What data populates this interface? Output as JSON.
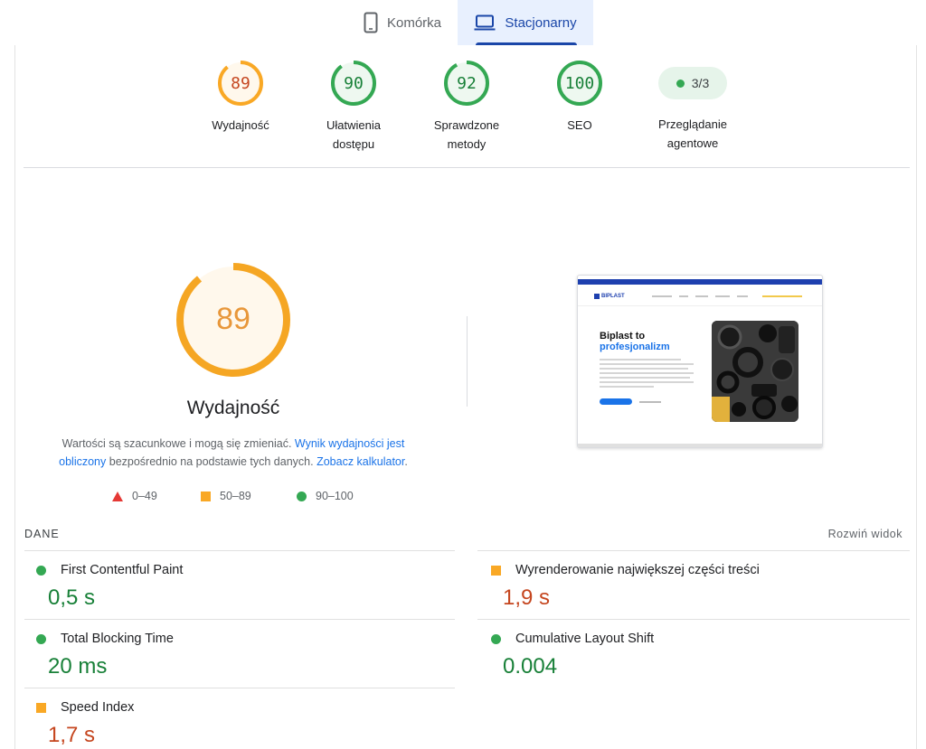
{
  "tabs": [
    {
      "label": "Komórka",
      "icon": "phone-icon"
    },
    {
      "label": "Stacjonarny",
      "icon": "laptop-icon",
      "active": true
    }
  ],
  "scores": [
    {
      "value": "89",
      "label": "Wydajność",
      "score": 0.89,
      "status": "average"
    },
    {
      "value": "90",
      "label": "Ułatwienia dostępu",
      "score": 0.9,
      "status": "good"
    },
    {
      "value": "92",
      "label": "Sprawdzone metody",
      "score": 0.92,
      "status": "good"
    },
    {
      "value": "100",
      "label": "SEO",
      "score": 1.0,
      "status": "good"
    }
  ],
  "agent": {
    "value": "3/3",
    "label": "Przeglądanie agentowe"
  },
  "performance": {
    "score": "89",
    "score_fraction": 0.89,
    "title": "Wydajność",
    "desc_pre": "Wartości są szacunkowe i mogą się zmieniać.",
    "desc_link1": "Wynik wydajności jest obliczony",
    "desc_mid": "bezpośrednio na podstawie tych danych.",
    "desc_link2": "Zobacz kalkulator",
    "desc_end": "."
  },
  "legend": [
    {
      "range": "0–49",
      "shape": "triangle"
    },
    {
      "range": "50–89",
      "shape": "square"
    },
    {
      "range": "90–100",
      "shape": "circle"
    }
  ],
  "thumbnail": {
    "logo": "BIPLAST",
    "headline_1": "Biplast to",
    "headline_2": "profesjonalizm"
  },
  "metrics_header": {
    "title": "DANE",
    "expand": "Rozwiń widok"
  },
  "metrics": [
    {
      "name": "First Contentful Paint",
      "value": "0,5 s",
      "status": "good"
    },
    {
      "name": "Wyrenderowanie największej części treści",
      "value": "1,9 s",
      "status": "average"
    },
    {
      "name": "Total Blocking Time",
      "value": "20 ms",
      "status": "good"
    },
    {
      "name": "Cumulative Layout Shift",
      "value": "0.004",
      "status": "good"
    },
    {
      "name": "Speed Index",
      "value": "1,7 s",
      "status": "average"
    }
  ],
  "colors": {
    "good": "#34a853",
    "good_text": "#188038",
    "average": "#f9a825",
    "average_text": "#c5461f",
    "fail": "#e53935",
    "link": "#1a73e8",
    "tab_active": "#1a46a8"
  }
}
